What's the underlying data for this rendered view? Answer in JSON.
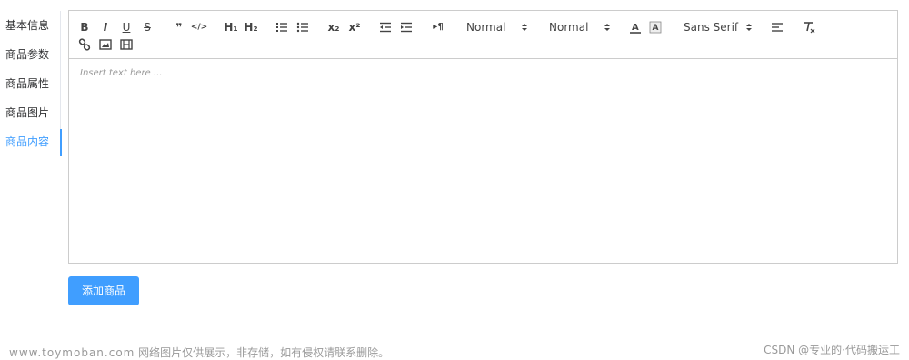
{
  "tabs": [
    {
      "label": "基本信息",
      "active": false
    },
    {
      "label": "商品参数",
      "active": false
    },
    {
      "label": "商品属性",
      "active": false
    },
    {
      "label": "商品图片",
      "active": false
    },
    {
      "label": "商品内容",
      "active": true
    }
  ],
  "toolbar": {
    "bold": "B",
    "italic": "I",
    "underline": "U",
    "strike": "S",
    "blockquote": "❞",
    "code": "</>",
    "h1": "H₁",
    "h2": "H₂",
    "subscript": "x₂",
    "superscript": "x²",
    "direction": "▸¶",
    "size_picker": "Normal",
    "header_picker": "Normal",
    "font_picker": "Sans Serif"
  },
  "editor": {
    "placeholder": "Insert text here ..."
  },
  "add_button": "添加商品",
  "footer": {
    "site": "www.toymoban.com",
    "note": " 网络图片仅供展示，非存储，如有侵权请联系删除。",
    "credit": "CSDN @专业的·代码搬运工"
  },
  "colors": {
    "accent": "#409eff",
    "border": "#cccccc",
    "text": "#303133",
    "muted": "#999999"
  }
}
